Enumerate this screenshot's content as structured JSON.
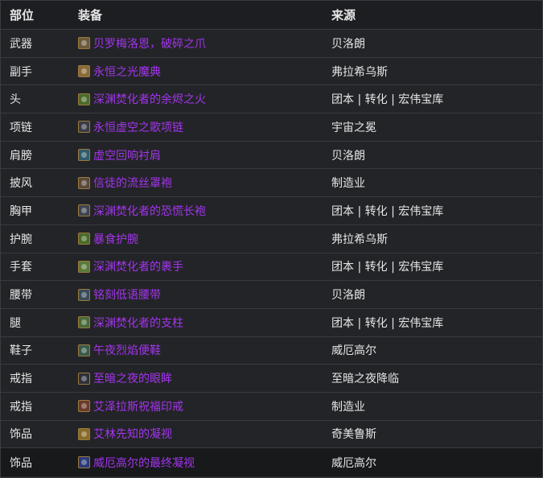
{
  "header": {
    "slot": "部位",
    "item": "装备",
    "source": "来源"
  },
  "rows": [
    {
      "slot": "武器",
      "item": "贝罗梅洛恩，破碎之爪",
      "source": "贝洛朗",
      "icon": "weapon-claw-icon",
      "icon_color": "#6b5b3b"
    },
    {
      "slot": "副手",
      "item": "永恒之光魔典",
      "source": "弗拉希乌斯",
      "icon": "tome-icon",
      "icon_color": "#8a6a3a"
    },
    {
      "slot": "头",
      "item": "深渊焚化者的余烬之火",
      "source": "团本 | 转化 | 宏伟宝库",
      "icon": "helm-icon",
      "icon_color": "#4b6b2a"
    },
    {
      "slot": "项链",
      "item": "永恒虚空之歌项链",
      "source": "宇宙之冕",
      "icon": "necklace-icon",
      "icon_color": "#3b3b46"
    },
    {
      "slot": "肩膀",
      "item": "虚空回响衬肩",
      "source": "贝洛朗",
      "icon": "shoulder-icon",
      "icon_color": "#2f5b6b"
    },
    {
      "slot": "披风",
      "item": "信徒的流丝罩袍",
      "source": "制造业",
      "icon": "cloak-icon",
      "icon_color": "#5a4a3a"
    },
    {
      "slot": "胸甲",
      "item": "深渊焚化者的恐慌长袍",
      "source": "团本 | 转化 | 宏伟宝库",
      "icon": "robe-icon",
      "icon_color": "#3e4450"
    },
    {
      "slot": "护腕",
      "item": "暴食护腕",
      "source": "弗拉希乌斯",
      "icon": "bracer-icon",
      "icon_color": "#4a6a2a"
    },
    {
      "slot": "手套",
      "item": "深渊焚化者的裹手",
      "source": "团本 | 转化 | 宏伟宝库",
      "icon": "gloves-icon",
      "icon_color": "#5a7a3a"
    },
    {
      "slot": "腰带",
      "item": "铭刻低语腰带",
      "source": "贝洛朗",
      "icon": "belt-icon",
      "icon_color": "#3a4c5a"
    },
    {
      "slot": "腿",
      "item": "深渊焚化者的支柱",
      "source": "团本 | 转化 | 宏伟宝库",
      "icon": "legs-icon",
      "icon_color": "#4a6a3a"
    },
    {
      "slot": "鞋子",
      "item": "午夜烈焰便鞋",
      "source": "威厄高尔",
      "icon": "boots-icon",
      "icon_color": "#3a5a4a"
    },
    {
      "slot": "戒指",
      "item": "至暗之夜的眼眸",
      "source": "至暗之夜降临",
      "icon": "ring-icon",
      "icon_color": "#2e2f38"
    },
    {
      "slot": "戒指",
      "item": "艾泽拉斯祝福印戒",
      "source": "制造业",
      "icon": "ring-icon",
      "icon_color": "#6a3a2a"
    },
    {
      "slot": "饰品",
      "item": "艾林先知的凝视",
      "source": "奇美鲁斯",
      "icon": "trinket-icon",
      "icon_color": "#8a6a2a"
    },
    {
      "slot": "饰品",
      "item": "威厄高尔的最终凝视",
      "source": "威厄高尔",
      "icon": "orb-icon",
      "icon_color": "#2a3a7a"
    }
  ],
  "colors": {
    "epic_item": "#a335ee",
    "text": "#e6e6e6",
    "row_bg": "#232427",
    "highlight_row_bg": "#18191b",
    "border": "#3a3b3f"
  }
}
